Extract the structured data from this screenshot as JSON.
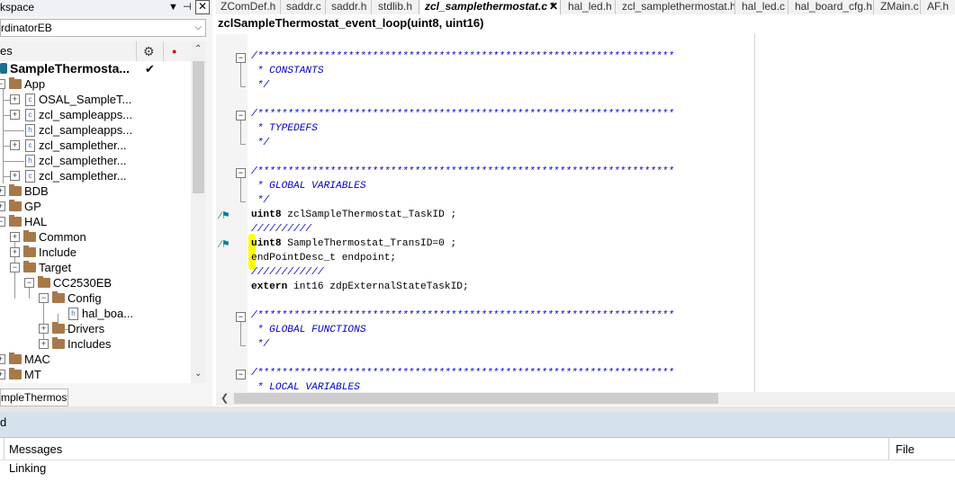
{
  "workspace": {
    "title": "kspace",
    "config": "rdinatorEB",
    "files_header": "es",
    "tab": "mpleThermostat",
    "tree": [
      {
        "label": "SampleThermosta...",
        "kind": "project",
        "checked": true
      },
      {
        "label": "App",
        "kind": "folder"
      },
      {
        "label": "OSAL_SampleT...",
        "kind": "c-file"
      },
      {
        "label": "zcl_sampleapps...",
        "kind": "c-file"
      },
      {
        "label": "zcl_sampleapps...",
        "kind": "h-file"
      },
      {
        "label": "zcl_samplether...",
        "kind": "c-file"
      },
      {
        "label": "zcl_samplether...",
        "kind": "h-file"
      },
      {
        "label": "zcl_samplether...",
        "kind": "c-file"
      },
      {
        "label": "BDB",
        "kind": "folder"
      },
      {
        "label": "GP",
        "kind": "folder"
      },
      {
        "label": "HAL",
        "kind": "folder"
      },
      {
        "label": "Common",
        "kind": "folder"
      },
      {
        "label": "Include",
        "kind": "folder"
      },
      {
        "label": "Target",
        "kind": "folder"
      },
      {
        "label": "CC2530EB",
        "kind": "folder"
      },
      {
        "label": "Config",
        "kind": "folder"
      },
      {
        "label": "hal_boa...",
        "kind": "h-file"
      },
      {
        "label": "Drivers",
        "kind": "folder"
      },
      {
        "label": "Includes",
        "kind": "folder"
      },
      {
        "label": "MAC",
        "kind": "folder"
      },
      {
        "label": "MT",
        "kind": "folder"
      }
    ]
  },
  "editor": {
    "tabs": [
      "ZComDef.h",
      "saddr.c",
      "saddr.h",
      "stdlib.h",
      "zcl_samplethermostat.c *",
      "hal_led.h",
      "zcl_samplethermostat.h",
      "hal_led.c",
      "hal_board_cfg.h",
      "ZMain.c",
      "AF.h"
    ],
    "active_tab": "zcl_samplethermostat.c *",
    "function_bar": "zclSampleThermostat_event_loop(uint8, uint16)",
    "lines": [
      "/*********************************************************************",
      " * CONSTANTS",
      " */",
      "/*********************************************************************",
      " * TYPEDEFS",
      " */",
      "/*********************************************************************",
      " * GLOBAL VARIABLES",
      " */",
      "uint8 zclSampleThermostat_TaskID ;",
      "//////////",
      "uint8 SampleThermostat_TransID=0 ;",
      "endPointDesc_t endpoint;",
      "////////////",
      "extern int16 zdpExternalStateTaskID;",
      "/*********************************************************************",
      " * GLOBAL FUNCTIONS",
      " */",
      "/*********************************************************************",
      " * LOCAL VARIABLES"
    ]
  },
  "bottom": {
    "panel_title": "d",
    "messages_header": "Messages",
    "file_header": "File",
    "rows": [
      "Linking"
    ]
  },
  "colors": {
    "comment": "#0000c8",
    "folder": "#a7794a",
    "highlight": "#ffff00",
    "panel_bar": "#d5e1ec"
  },
  "icons": [
    "pin-icon",
    "close-icon",
    "gear-icon",
    "record-icon",
    "checkmark-icon",
    "expand-icon",
    "collapse-icon",
    "folder-icon",
    "c-file-icon",
    "h-file-icon",
    "bookmark-icon",
    "scroll-left-icon",
    "dropdown-arrow-icon"
  ]
}
